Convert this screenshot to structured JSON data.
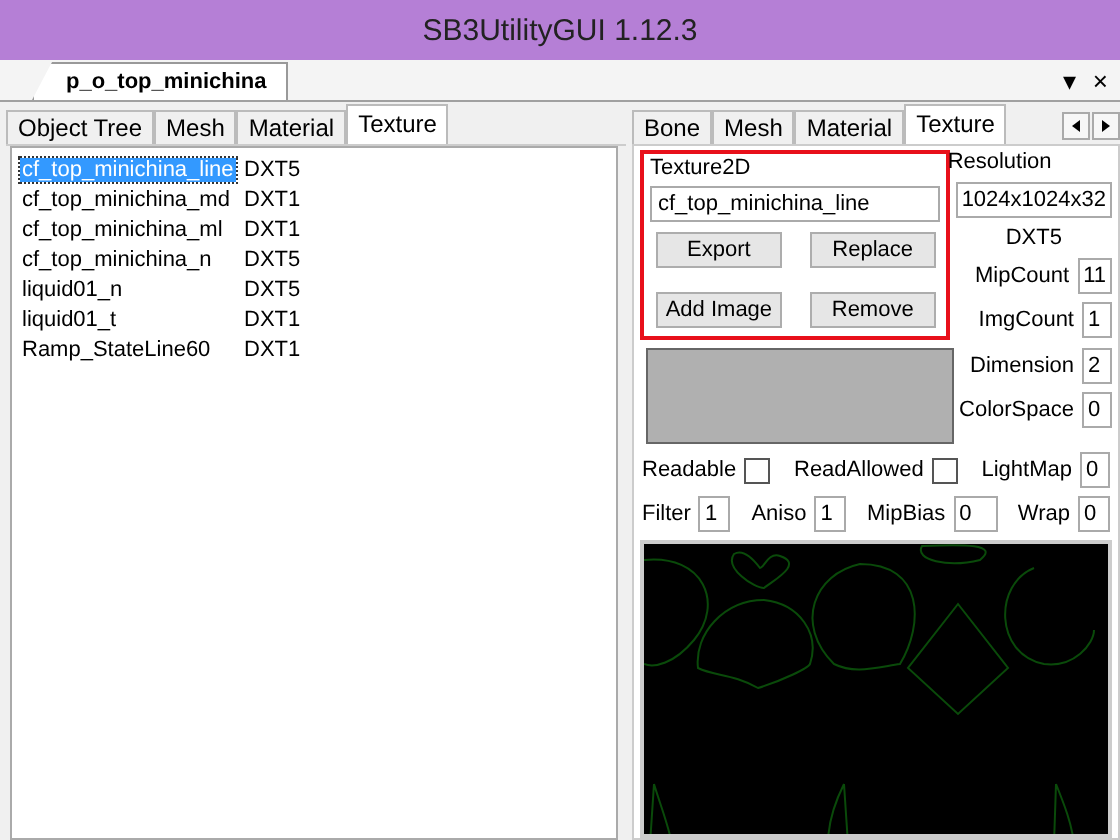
{
  "window": {
    "title": "SB3UtilityGUI 1.12.3"
  },
  "document_tabs": [
    {
      "label": "p_o_top_minichina",
      "selected": true
    }
  ],
  "document_controls": [
    "▾",
    "×"
  ],
  "left_tabs": [
    {
      "label": "Object Tree",
      "selected": false
    },
    {
      "label": "Mesh",
      "selected": false
    },
    {
      "label": "Material",
      "selected": false
    },
    {
      "label": "Texture",
      "selected": true
    }
  ],
  "textures": [
    {
      "name": "cf_top_minichina_line",
      "format": "DXT5",
      "selected": true
    },
    {
      "name": "cf_top_minichina_md",
      "format": "DXT1",
      "selected": false
    },
    {
      "name": "cf_top_minichina_ml",
      "format": "DXT1",
      "selected": false
    },
    {
      "name": "cf_top_minichina_n",
      "format": "DXT5",
      "selected": false
    },
    {
      "name": "liquid01_n",
      "format": "DXT5",
      "selected": false
    },
    {
      "name": "liquid01_t",
      "format": "DXT1",
      "selected": false
    },
    {
      "name": "Ramp_StateLine60",
      "format": "DXT1",
      "selected": false
    }
  ],
  "right_tabs": [
    {
      "label": "Bone",
      "selected": false
    },
    {
      "label": "Mesh",
      "selected": false
    },
    {
      "label": "Material",
      "selected": false
    },
    {
      "label": "Texture",
      "selected": true
    }
  ],
  "editor": {
    "group_label": "Texture2D",
    "name_value": "cf_top_minichina_line",
    "buttons": [
      "Export",
      "Replace",
      "Add Image",
      "Remove"
    ],
    "resolution_label": "Resolution",
    "resolution_value": "1024x1024x32",
    "format": "DXT5",
    "side_fields": [
      {
        "label": "MipCount",
        "value": "11"
      },
      {
        "label": "ImgCount",
        "value": "1"
      }
    ],
    "swatch_fields": [
      {
        "label": "Dimension",
        "value": "2"
      },
      {
        "label": "ColorSpace",
        "value": "0"
      }
    ],
    "checks": [
      {
        "label": "Readable",
        "checked": false
      },
      {
        "label": "ReadAllowed",
        "checked": false
      }
    ],
    "lightmap": {
      "label": "LightMap",
      "value": "0"
    },
    "bottom_fields": [
      {
        "label": "Filter",
        "value": "1"
      },
      {
        "label": "Aniso",
        "value": "1"
      },
      {
        "label": "MipBias",
        "value": "0"
      },
      {
        "label": "Wrap",
        "value": "0"
      }
    ]
  }
}
